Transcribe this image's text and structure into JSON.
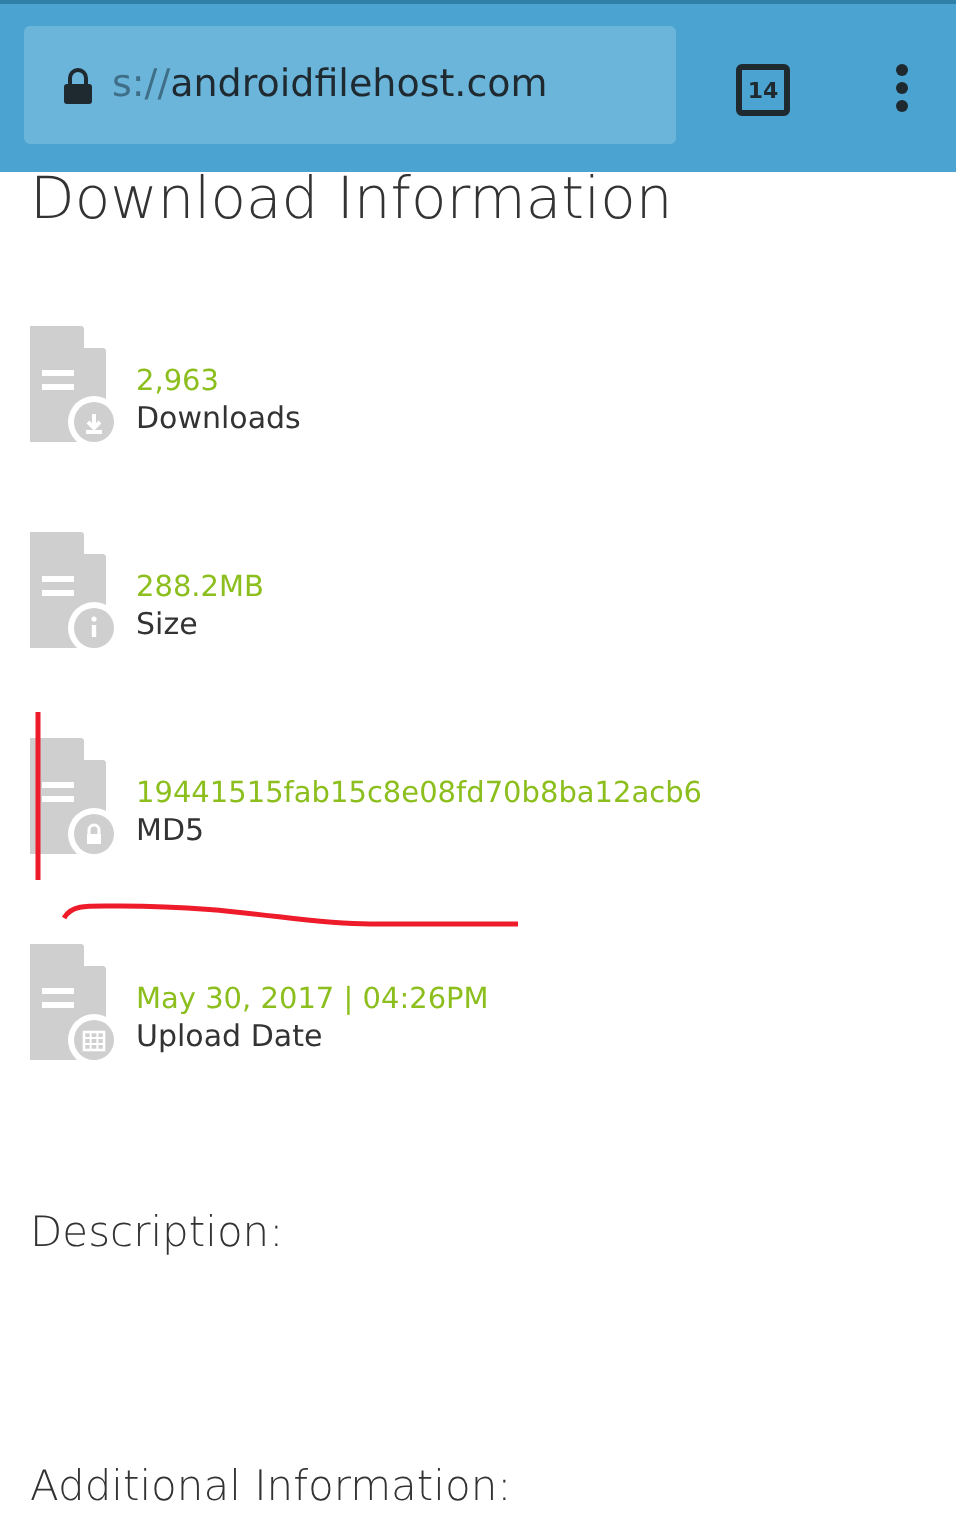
{
  "browser_bar": {
    "url_scheme": "s://",
    "url_host": "androidfilehost.com",
    "tab_count": "14"
  },
  "heading": "Download Information",
  "stats": [
    {
      "value": "2,963",
      "label": "Downloads",
      "kind": "download"
    },
    {
      "value": "288.2MB",
      "label": "Size",
      "kind": "info"
    },
    {
      "value": "19441515fab15c8e08fd70b8ba12acb6",
      "label": "MD5",
      "kind": "lock"
    },
    {
      "value": "May 30, 2017 | 04:26PM",
      "label": "Upload Date",
      "kind": "calendar"
    }
  ],
  "sections": [
    "Description:",
    "Additional Information:"
  ]
}
